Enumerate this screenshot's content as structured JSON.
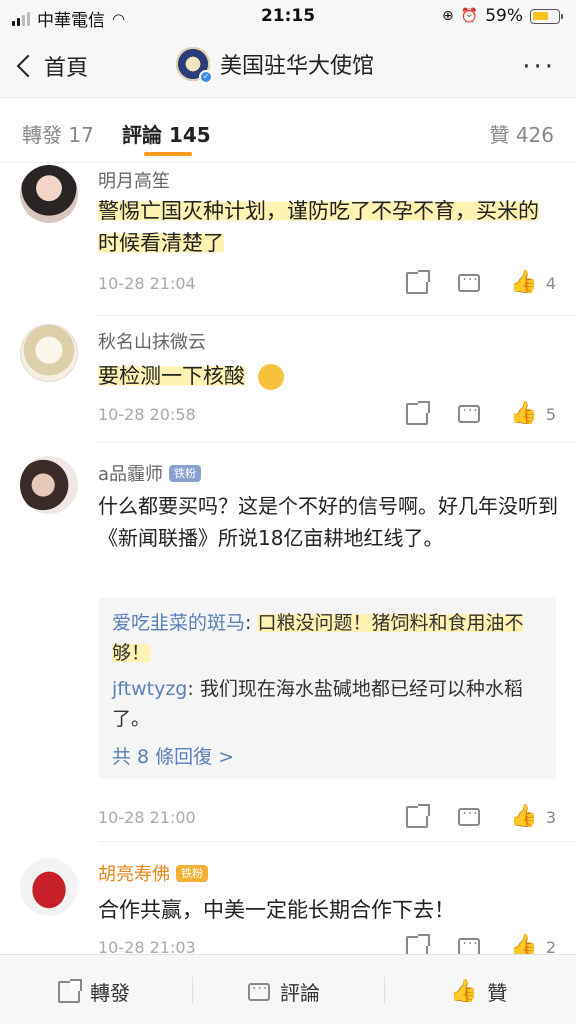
{
  "status": {
    "carrier": "中華電信",
    "time": "21:15",
    "battery": "59%"
  },
  "nav": {
    "back_label": "首頁",
    "title": "美国驻华大使馆",
    "more": "···"
  },
  "tabs": {
    "repost": "轉發 17",
    "comment": "評論 145",
    "like": "贊 426"
  },
  "comments": [
    {
      "name": "明月高笙",
      "text": "警惕亡国灭种计划，谨防吃了不孕不育，买米的时候看清楚了",
      "time": "10-28 21:04",
      "likes": "4"
    },
    {
      "name": "秋名山抹微云",
      "text": "要检测一下核酸",
      "time": "10-28 20:58",
      "likes": "5"
    },
    {
      "name": "a品霾师",
      "badge": "铁粉",
      "text": "什么都要买吗？这是个不好的信号啊。好几年没听到《新闻联播》所说18亿亩耕地红线了。",
      "time": "10-28 21:00",
      "likes": "3",
      "replies": [
        {
          "name": "爱吃韭菜的斑马",
          "text": "口粮没问题！猪饲料和食用油不够！"
        },
        {
          "name": "jftwtyzg",
          "text": "我们现在海水盐碱地都已经可以种水稻了。"
        }
      ],
      "more_replies": "共 8 條回復 >"
    },
    {
      "name": "胡亮寿佛",
      "badge": "铁粉",
      "text": "合作共赢，中美一定能长期合作下去！",
      "time": "10-28 21:03",
      "likes": "2"
    }
  ],
  "bottom": {
    "repost": "轉發",
    "comment": "評論",
    "like": "贊"
  },
  "colors": {
    "accent": "#f79a1e",
    "highlight": "#fff3b3",
    "link": "#5b7fb8",
    "orange_name": "#e8861a"
  }
}
